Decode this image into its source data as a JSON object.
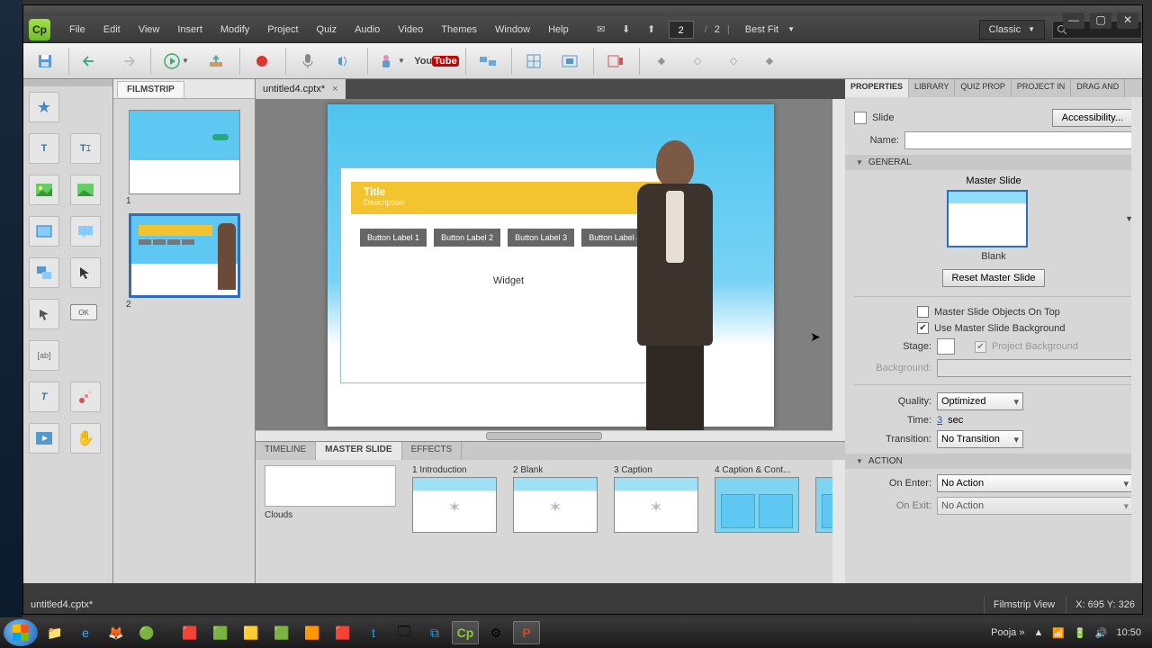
{
  "menus": [
    "File",
    "Edit",
    "View",
    "Insert",
    "Modify",
    "Project",
    "Quiz",
    "Audio",
    "Video",
    "Themes",
    "Window",
    "Help"
  ],
  "page": {
    "current": "2",
    "total": "2"
  },
  "zoom_label": "Best Fit",
  "workspace": "Classic",
  "doc_tab": "untitled4.cptx*",
  "filmstrip_title": "FILMSTRIP",
  "slide_nums": [
    "1",
    "2"
  ],
  "stage": {
    "title": "Title",
    "subtitle": "Description",
    "btns": [
      "Button Label 1",
      "Button Label 2",
      "Button Label 3",
      "Button Label 4"
    ],
    "widget": "Widget"
  },
  "bottom_tabs": [
    "TIMELINE",
    "MASTER SLIDE",
    "EFFECTS"
  ],
  "master_theme": "Clouds",
  "masters": [
    "1 Introduction",
    "2 Blank",
    "3 Caption",
    "4 Caption & Cont..."
  ],
  "right_tabs": [
    "PROPERTIES",
    "LIBRARY",
    "QUIZ PROP",
    "PROJECT IN",
    "DRAG AND"
  ],
  "props": {
    "slide_label": "Slide",
    "accessibility": "Accessibility...",
    "name_label": "Name:",
    "name_value": "",
    "general": "GENERAL",
    "master_slide_label": "Master Slide",
    "master_slide_value": "Blank",
    "reset": "Reset Master Slide",
    "objects_on_top": "Master Slide Objects On Top",
    "use_bg": "Use Master Slide Background",
    "stage_label": "Stage:",
    "proj_bg": "Project Background",
    "bg_label": "Background:",
    "quality_label": "Quality:",
    "quality_value": "Optimized",
    "time_label": "Time:",
    "time_value": "3",
    "time_unit": "sec",
    "transition_label": "Transition:",
    "transition_value": "No Transition",
    "action": "ACTION",
    "on_enter_label": "On Enter:",
    "on_enter_value": "No Action",
    "on_exit_label": "On Exit:",
    "on_exit_value": "No Action"
  },
  "status": {
    "file": "untitled4.cptx*",
    "view": "Filmstrip View",
    "coords": "X: 695 Y: 326"
  },
  "tray": {
    "user": "Pooja",
    "time": "10:50"
  }
}
